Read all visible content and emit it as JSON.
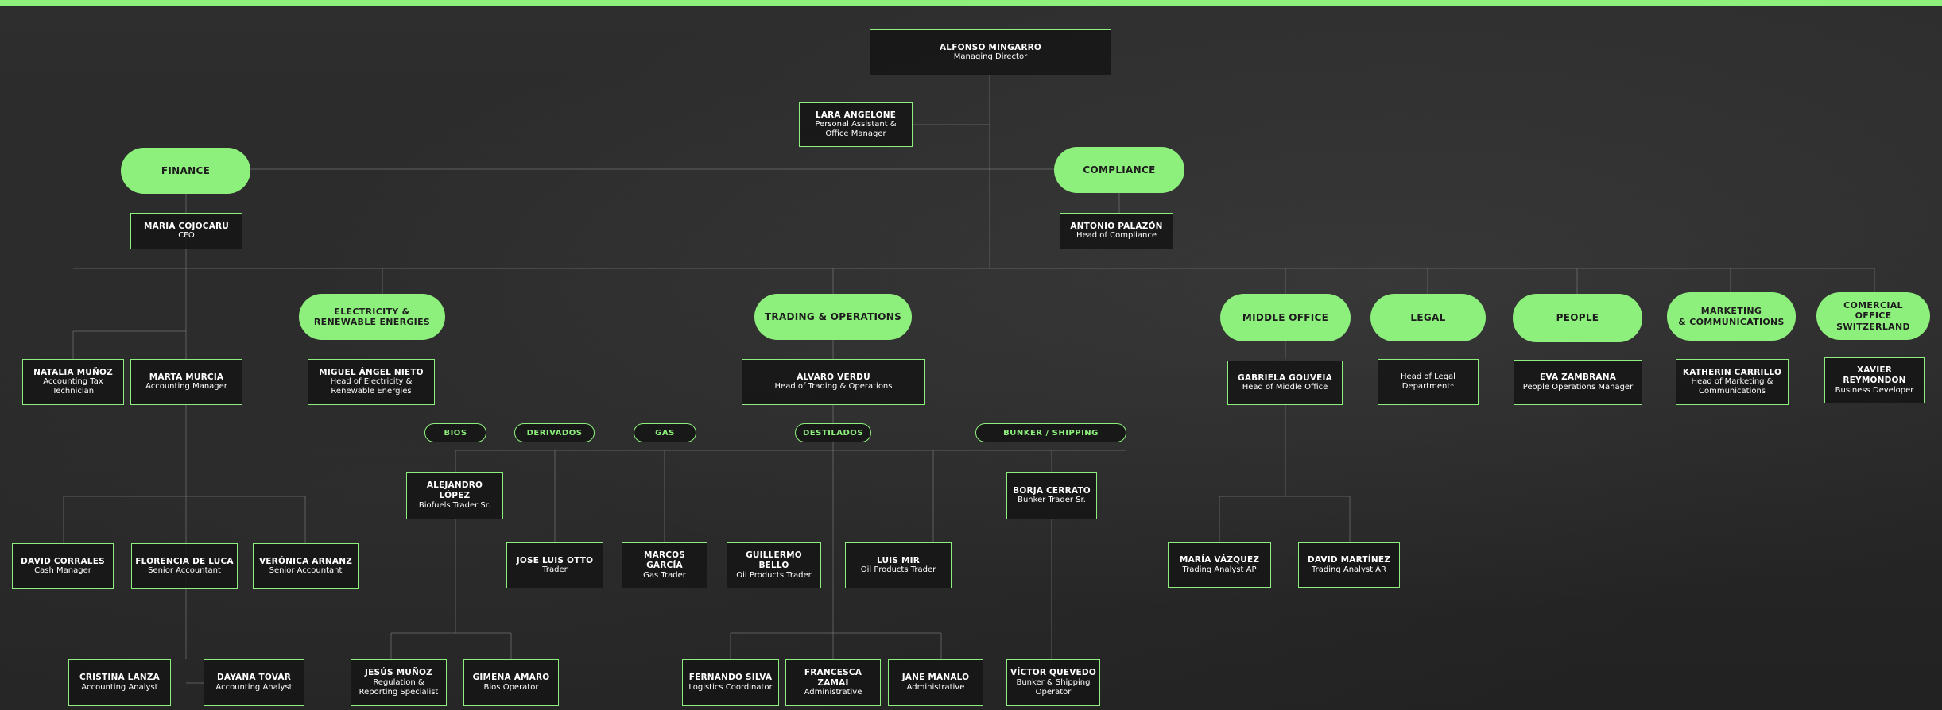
{
  "departments": [
    {
      "key": "finance",
      "label": "FINANCE"
    },
    {
      "key": "compliance",
      "label": "COMPLIANCE"
    },
    {
      "key": "electricity",
      "label": "ELECTRICITY &\nRENEWABLE ENERGIES"
    },
    {
      "key": "trading",
      "label": "TRADING & OPERATIONS"
    },
    {
      "key": "middle",
      "label": "MIDDLE OFFICE"
    },
    {
      "key": "legal",
      "label": "LEGAL"
    },
    {
      "key": "people",
      "label": "PEOPLE"
    },
    {
      "key": "marketing",
      "label": "MARKETING\n& COMMUNICATIONS"
    },
    {
      "key": "switzerland",
      "label": "COMERCIAL\nOFFICE\nSWITZERLAND"
    }
  ],
  "desks": [
    {
      "key": "bios",
      "label": "BIOS"
    },
    {
      "key": "derivados",
      "label": "DERIVADOS"
    },
    {
      "key": "gas",
      "label": "GAS"
    },
    {
      "key": "destilados",
      "label": "DESTILADOS"
    },
    {
      "key": "bunker",
      "label": "BUNKER / SHIPPING"
    }
  ],
  "people": [
    {
      "key": "mingarro",
      "name": "ALFONSO MINGARRO",
      "role": "Managing Director"
    },
    {
      "key": "angelone",
      "name": "LARA ANGELONE",
      "role": "Personal Assistant & Office Manager"
    },
    {
      "key": "cojocaru",
      "name": "MARIA COJOCARU",
      "role": "CFO"
    },
    {
      "key": "palazon",
      "name": "ANTONIO PALAZÓN",
      "role": "Head of Compliance"
    },
    {
      "key": "munozn",
      "name": "NATALIA MUÑOZ",
      "role": "Accounting Tax Technician"
    },
    {
      "key": "murcia",
      "name": "MARTA MURCIA",
      "role": "Accounting Manager"
    },
    {
      "key": "nieto",
      "name": "MIGUEL ÁNGEL NIETO",
      "role": "Head of Electricity & Renewable Energies"
    },
    {
      "key": "verdu",
      "name": "ÁLVARO VERDÚ",
      "role": "Head of Trading & Operations"
    },
    {
      "key": "gouveia",
      "name": "GABRIELA GOUVEIA",
      "role": "Head of Middle Office"
    },
    {
      "key": "legalhead",
      "name": "",
      "role": "Head of Legal Department*"
    },
    {
      "key": "zambrana",
      "name": "EVA ZAMBRANA",
      "role": "People Operations Manager"
    },
    {
      "key": "carrillo",
      "name": "KATHERIN CARRILLO",
      "role": "Head of Marketing & Communications"
    },
    {
      "key": "reymondon",
      "name": "XAVIER REYMONDON",
      "role": "Business Developer"
    },
    {
      "key": "lopez",
      "name": "ALEJANDRO LÓPEZ",
      "role": "Biofuels Trader Sr."
    },
    {
      "key": "cerrato",
      "name": "BORJA CERRATO",
      "role": "Bunker Trader Sr."
    },
    {
      "key": "corrales",
      "name": "DAVID CORRALES",
      "role": "Cash Manager"
    },
    {
      "key": "deluca",
      "name": "FLORENCIA DE LUCA",
      "role": "Senior Accountant"
    },
    {
      "key": "arnanz",
      "name": "VERÓNICA ARNANZ",
      "role": "Senior Accountant"
    },
    {
      "key": "otto",
      "name": "JOSE LUIS OTTO",
      "role": "Trader"
    },
    {
      "key": "garcia",
      "name": "MARCOS GARCÍA",
      "role": "Gas Trader"
    },
    {
      "key": "bello",
      "name": "GUILLERMO BELLO",
      "role": "Oil Products Trader"
    },
    {
      "key": "mir",
      "name": "LUIS MIR",
      "role": "Oil Products Trader"
    },
    {
      "key": "vazquez",
      "name": "MARÍA VÁZQUEZ",
      "role": "Trading Analyst AP"
    },
    {
      "key": "martinez",
      "name": "DAVID MARTÍNEZ",
      "role": "Trading Analyst AR"
    },
    {
      "key": "lanza",
      "name": "CRISTINA LANZA",
      "role": "Accounting Analyst"
    },
    {
      "key": "tovar",
      "name": "DAYANA TOVAR",
      "role": "Accounting Analyst"
    },
    {
      "key": "munozj",
      "name": "JESÚS MUÑOZ",
      "role": "Regulation & Reporting Specialist"
    },
    {
      "key": "amaro",
      "name": "GIMENA AMARO",
      "role": "Bios Operator"
    },
    {
      "key": "silva",
      "name": "FERNANDO SILVA",
      "role": "Logistics Coordinator"
    },
    {
      "key": "zamai",
      "name": "FRANCESCA ZAMAI",
      "role": "Administrative"
    },
    {
      "key": "manalo",
      "name": "JANE MANALO",
      "role": "Administrative"
    },
    {
      "key": "quevedo",
      "name": "VÍCTOR QUEVEDO",
      "role": "Bunker & Shipping Operator"
    }
  ],
  "colors": {
    "accent": "#8ef07c",
    "background": "#2a2a2a",
    "box_fill": "#161616",
    "text": "#ffffff"
  }
}
